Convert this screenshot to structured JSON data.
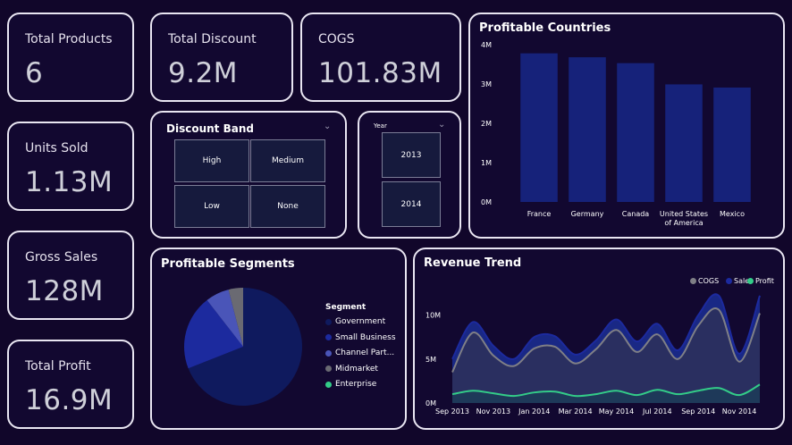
{
  "kpis": {
    "total_products": {
      "label": "Total Products",
      "value": "6"
    },
    "units_sold": {
      "label": "Units Sold",
      "value": "1.13M"
    },
    "gross_sales": {
      "label": "Gross Sales",
      "value": "128M"
    },
    "total_profit": {
      "label": "Total Profit",
      "value": "16.9M"
    },
    "total_discount": {
      "label": "Total Discount",
      "value": "9.2M"
    },
    "cogs": {
      "label": "COGS",
      "value": "101.83M"
    }
  },
  "discount_band": {
    "title": "Discount Band",
    "options": [
      "High",
      "Medium",
      "Low",
      "None"
    ]
  },
  "year_slicer": {
    "title": "Year",
    "options": [
      "2013",
      "2014"
    ]
  },
  "icons": {
    "dropdown": "chevron-down-icon"
  },
  "colors": {
    "background": "#11062a",
    "card_border": "#e9e6f2",
    "bar": "#16227a",
    "cogs": "#7f7f86",
    "sales": "#1c2a9e",
    "profit": "#33cc88"
  },
  "chart_data": [
    {
      "type": "bar",
      "title": "Profitable Countries",
      "categories": [
        "France",
        "Germany",
        "Canada",
        "United States of America",
        "Mexico"
      ],
      "category_display": [
        [
          "France"
        ],
        [
          "Germany"
        ],
        [
          "Canada"
        ],
        [
          "United States",
          "of America"
        ],
        [
          "Mexico"
        ]
      ],
      "values": [
        3.78,
        3.68,
        3.53,
        2.99,
        2.91
      ],
      "ylim": [
        0,
        4
      ],
      "yticks": [
        0,
        1,
        2,
        3,
        4
      ],
      "ytick_labels": [
        "0M",
        "1M",
        "2M",
        "3M",
        "4M"
      ],
      "grid": false
    },
    {
      "type": "pie",
      "title": "Profitable Segments",
      "legend_title": "Segment",
      "labels": [
        "Government",
        "Small Business",
        "Channel Part...",
        "Midmarket",
        "Enterprise"
      ],
      "values": [
        69.0,
        20.5,
        6.5,
        4.0,
        0.0
      ],
      "colors": [
        "#0f1a5e",
        "#1c2a9e",
        "#4a55b8",
        "#6a6a72",
        "#33cc88"
      ]
    },
    {
      "type": "area",
      "title": "Revenue Trend",
      "legend": [
        "COGS",
        "Sales",
        "Profit"
      ],
      "legend_placement": "top-right",
      "x": [
        "Sep 2013",
        "Oct 2013",
        "Nov 2013",
        "Dec 2013",
        "Jan 2014",
        "Feb 2014",
        "Mar 2014",
        "Apr 2014",
        "May 2014",
        "Jun 2014",
        "Jul 2014",
        "Aug 2014",
        "Sep 2014",
        "Oct 2014",
        "Nov 2014",
        "Dec 2014"
      ],
      "xtick_labels": [
        "Sep 2013",
        "Nov 2013",
        "Jan 2014",
        "Mar 2014",
        "May 2014",
        "Jul 2014",
        "Sep 2014",
        "Nov 2014"
      ],
      "ylim": [
        0,
        13
      ],
      "yticks": [
        0,
        5,
        10
      ],
      "ytick_labels": [
        "0M",
        "5M",
        "10M"
      ],
      "series": [
        {
          "name": "Sales",
          "values": [
            5.0,
            9.2,
            6.5,
            5.0,
            7.5,
            7.6,
            5.5,
            7.1,
            9.5,
            7.0,
            9.0,
            6.0,
            10.0,
            12.2,
            5.6,
            12.2
          ]
        },
        {
          "name": "COGS",
          "values": [
            3.5,
            8.0,
            5.4,
            4.2,
            6.2,
            6.4,
            4.5,
            6.1,
            8.3,
            5.8,
            7.8,
            5.0,
            8.8,
            10.6,
            4.7,
            10.2
          ]
        },
        {
          "name": "Profit",
          "values": [
            1.0,
            1.4,
            1.1,
            0.8,
            1.2,
            1.3,
            0.8,
            1.0,
            1.4,
            0.9,
            1.5,
            1.0,
            1.4,
            1.7,
            0.9,
            2.1
          ]
        }
      ]
    }
  ]
}
